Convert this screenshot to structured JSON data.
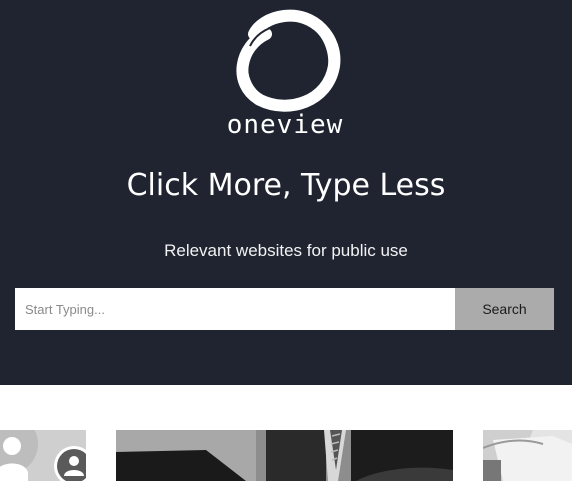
{
  "brand": {
    "logo_text": "oneview"
  },
  "hero": {
    "headline": "Click More, Type Less",
    "subhead": "Relevant websites for public use"
  },
  "search": {
    "placeholder": "Start Typing...",
    "button_label": "Search"
  },
  "colors": {
    "hero_background": "#1f2430",
    "search_button": "#ababab"
  },
  "cards": [
    {
      "image": "users-icon-thumbnail"
    },
    {
      "image": "business-photo-thumbnail"
    },
    {
      "image": "document-photo-thumbnail"
    }
  ]
}
